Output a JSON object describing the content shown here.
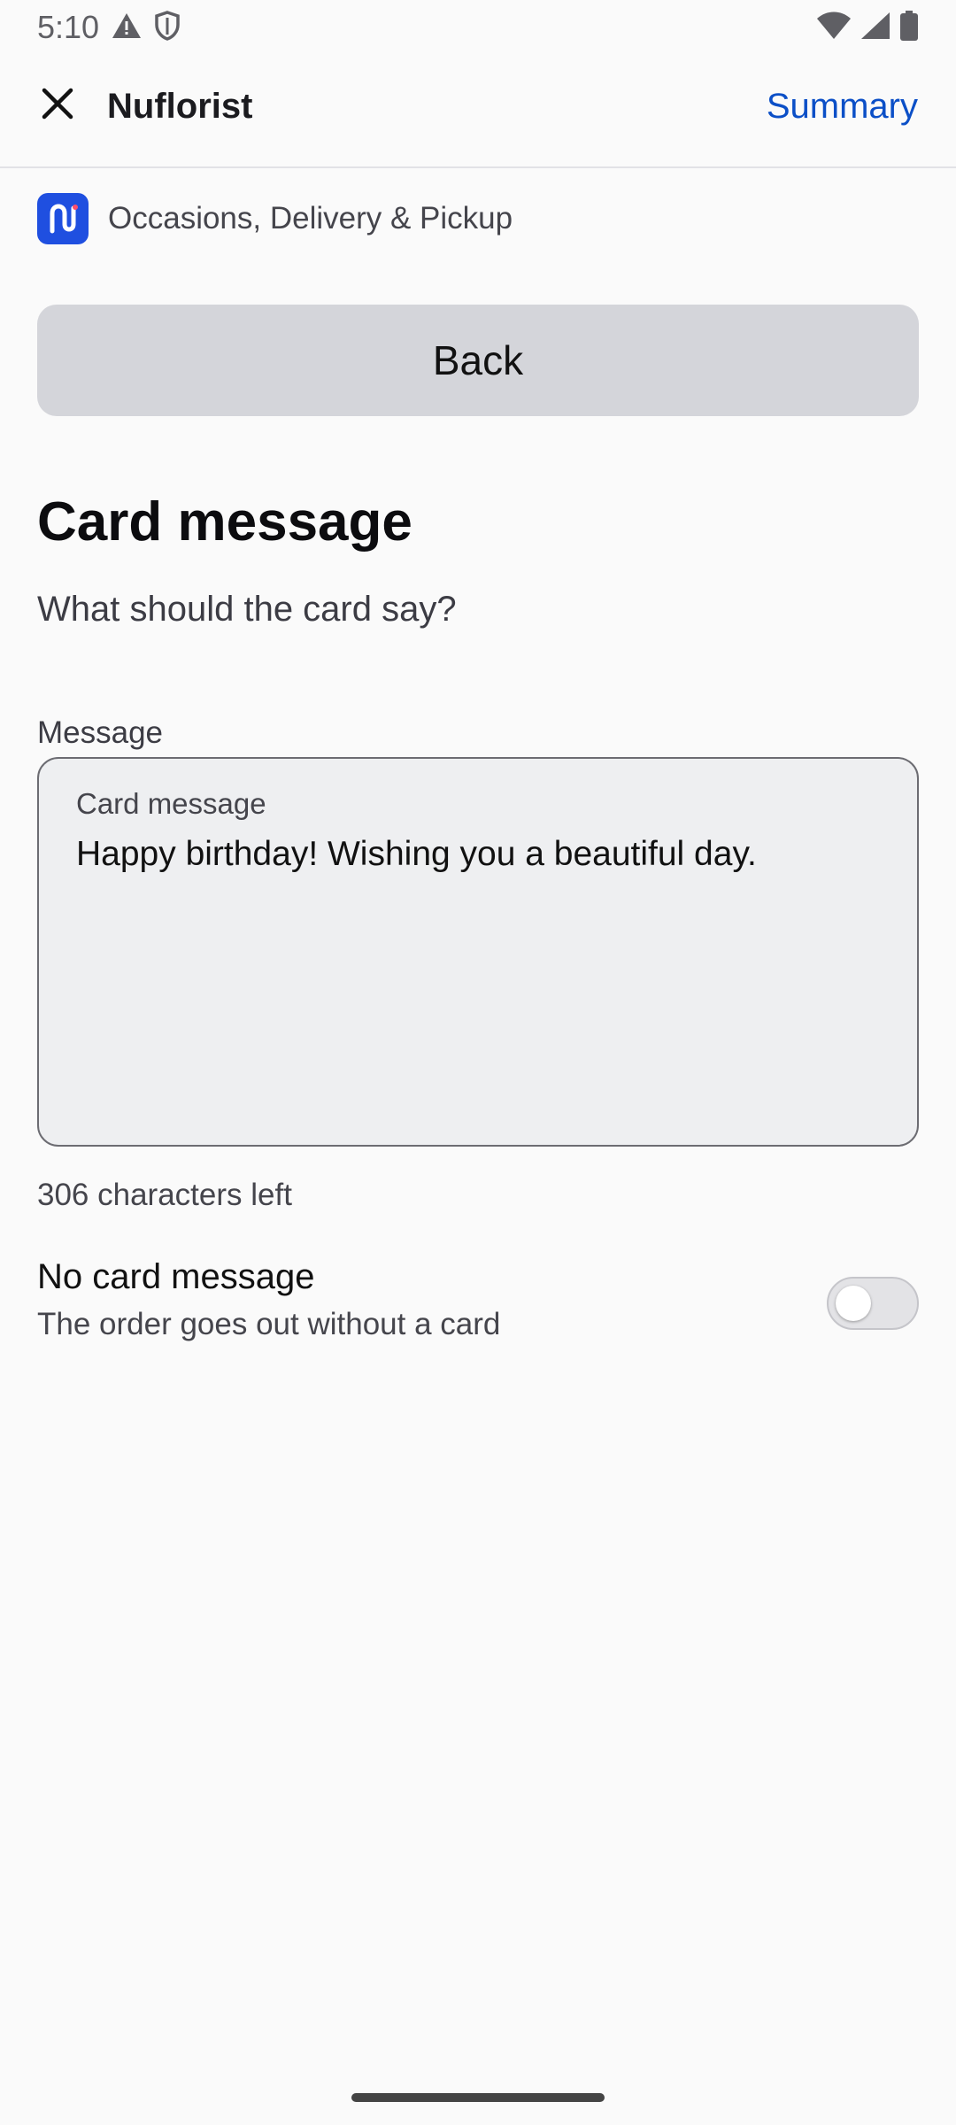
{
  "status_bar": {
    "time": "5:10",
    "left_icons": [
      "warning-icon",
      "shield-icon"
    ],
    "right_icons": [
      "wifi-icon",
      "signal-icon",
      "battery-icon"
    ]
  },
  "app_bar": {
    "title": "Nuflorist",
    "summary_label": "Summary",
    "close_icon": "close-icon"
  },
  "breadcrumb": {
    "text": "Occasions, Delivery & Pickup",
    "brand_color": "#1f4fe0"
  },
  "back_button": {
    "label": "Back"
  },
  "main": {
    "title": "Card message",
    "subtitle": "What should the card say?",
    "field_label": "Message",
    "textarea": {
      "label": "Card message",
      "value": "Happy birthday! Wishing you a beautiful day."
    },
    "counter": "306 characters left",
    "toggle": {
      "title": "No card message",
      "description": "The order goes out without a card",
      "checked": false
    }
  },
  "colors": {
    "accent": "#0b4fc7",
    "background": "#fafafa",
    "button_bg": "#d4d5da",
    "field_bg": "#eeeff1"
  }
}
